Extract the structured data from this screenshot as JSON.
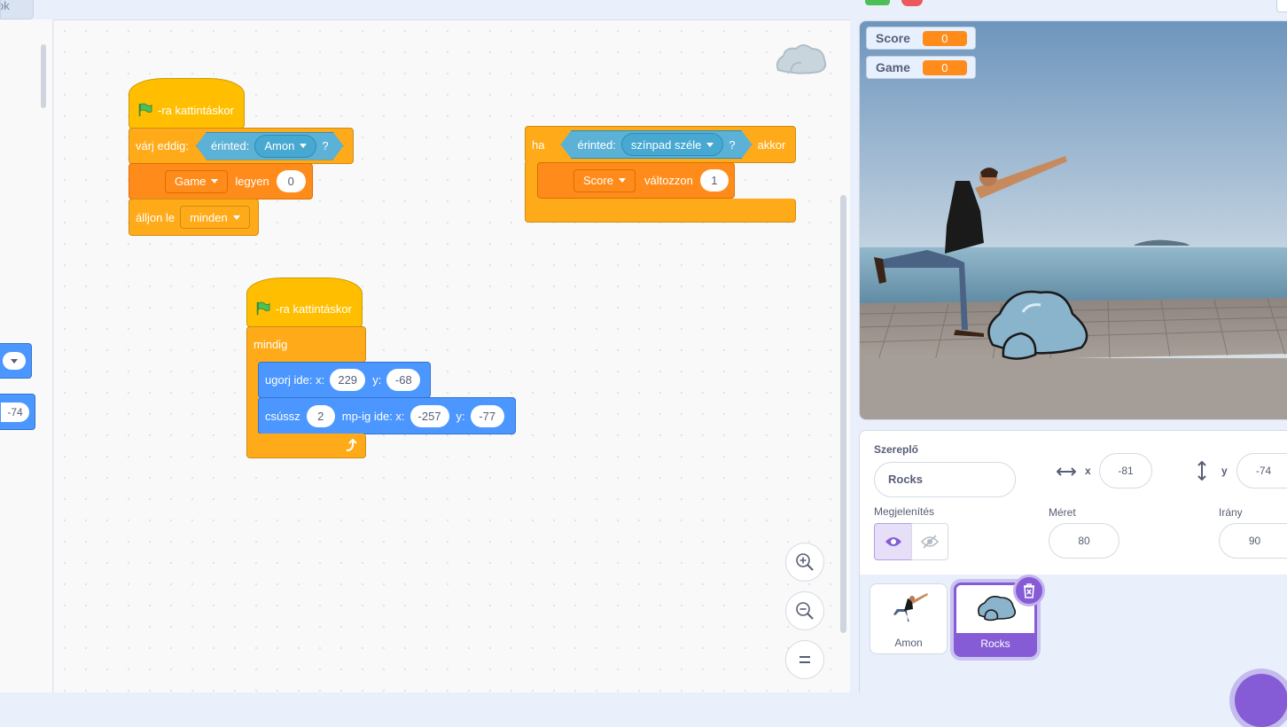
{
  "top": {
    "partial_tab_label": "ok"
  },
  "palette": {
    "partial_value": "-74"
  },
  "scripts": {
    "script1": {
      "hat_label": "-ra kattintáskor",
      "wait_label": "várj eddig:",
      "touching_label": "érinted:",
      "touching_target": "Amon",
      "question_mark": "?",
      "set_var": "Game",
      "set_label": "legyen",
      "set_value": "0",
      "stop_label": "álljon le",
      "stop_option": "minden"
    },
    "script2": {
      "if_label": "ha",
      "touching_label": "érinted:",
      "touching_target": "színpad széle",
      "question_mark": "?",
      "then_label": "akkor",
      "change_var": "Score",
      "change_label": "változzon",
      "change_value": "1"
    },
    "script3": {
      "hat_label": "-ra kattintáskor",
      "forever_label": "mindig",
      "goto_label": "ugorj ide: x:",
      "goto_x": "229",
      "goto_y_label": "y:",
      "goto_y": "-68",
      "glide_label": "csússz",
      "glide_secs": "2",
      "glide_mid_label": "mp-ig ide: x:",
      "glide_x": "-257",
      "glide_y_label": "y:",
      "glide_y": "-77"
    }
  },
  "stage": {
    "monitors": [
      {
        "name": "Score",
        "value": "0"
      },
      {
        "name": "Game",
        "value": "0"
      }
    ]
  },
  "sprite_info": {
    "sprite_label": "Szereplő",
    "sprite_name": "Rocks",
    "x_label": "x",
    "x_value": "-81",
    "y_label": "y",
    "y_value": "-74",
    "show_label": "Megjelenítés",
    "size_label": "Méret",
    "size_value": "80",
    "direction_label": "Irány",
    "direction_value": "90"
  },
  "sprites": [
    {
      "name": "Amon",
      "selected": false
    },
    {
      "name": "Rocks",
      "selected": true
    }
  ],
  "colors": {
    "accent": "#855cd6",
    "events": "#ffbf00",
    "control": "#ffab19",
    "variables": "#ff8c1a",
    "motion": "#4c97ff",
    "sensing": "#5cb1d6"
  }
}
